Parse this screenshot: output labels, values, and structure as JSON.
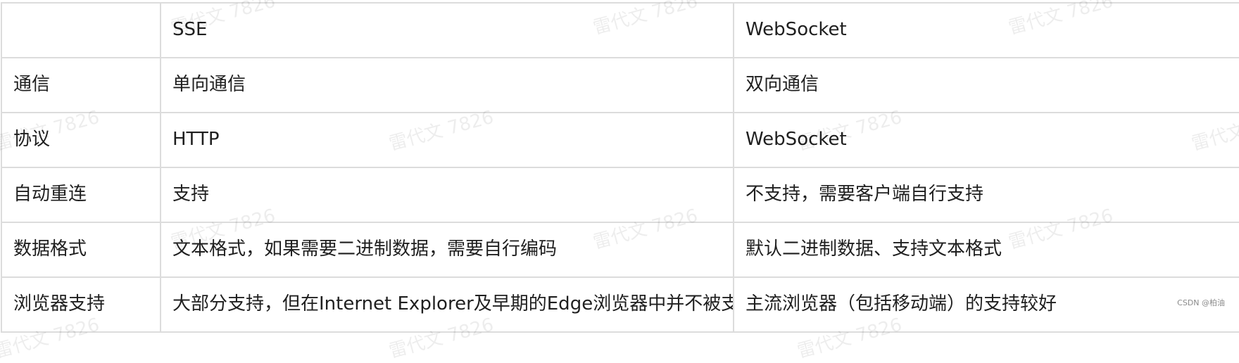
{
  "table": {
    "header": [
      "",
      "SSE",
      "WebSocket"
    ],
    "rows": [
      [
        "通信",
        "单向通信",
        "双向通信"
      ],
      [
        "协议",
        "HTTP",
        "WebSocket"
      ],
      [
        "自动重连",
        "支持",
        "不支持，需要客户端自行支持"
      ],
      [
        "数据格式",
        "文本格式，如果需要二进制数据，需要自行编码",
        "默认二进制数据、支持文本格式"
      ],
      [
        "浏览器支持",
        "大部分支持，但在Internet Explorer及早期的Edge浏览器中并不被支持",
        "主流浏览器（包括移动端）的支持较好"
      ]
    ]
  },
  "watermark": "雷代文 7826",
  "credit": "CSDN @柏油"
}
